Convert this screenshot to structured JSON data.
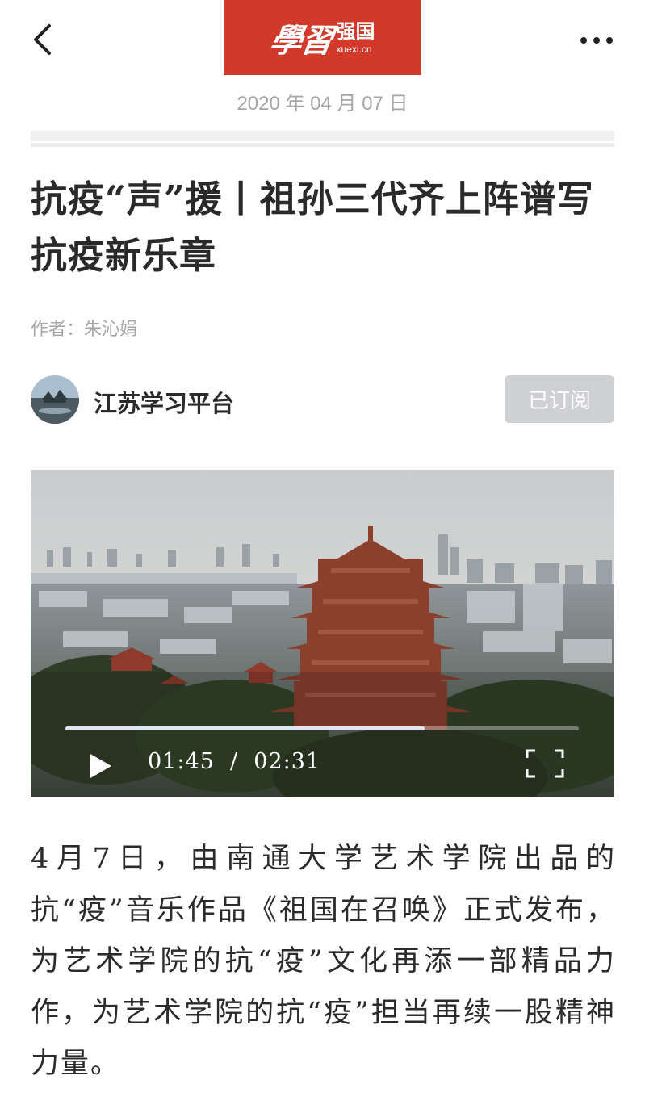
{
  "header": {
    "logo_script": "學習",
    "logo_name": "强国",
    "logo_domain": "xuexi.cn",
    "back_icon": "chevron-left-icon",
    "more_icon": "more-horizontal-icon"
  },
  "article": {
    "date": "2020 年 04 月 07 日",
    "title": "抗疫“声”援丨祖孙三代齐上阵谱写抗疫新乐章",
    "author": "作者：朱沁娟",
    "body": "4月7日，由南通大学艺术学院出品的抗“疫”音乐作品《祖国在召唤》正式发布，为艺术学院的抗“疫”文化再添一部精品力作，为艺术学院的抗“疫”担当再续一股精神力量。"
  },
  "channel": {
    "name": "江苏学习平台",
    "subscribe_label": "已订阅"
  },
  "video": {
    "current_time": "01:45",
    "separator": "/",
    "duration": "02:31",
    "progress": 0.7
  },
  "colors": {
    "brand": "#d13a2a",
    "muted_text": "#a6a6a6",
    "subscribed_button": "#cfd0d3"
  }
}
